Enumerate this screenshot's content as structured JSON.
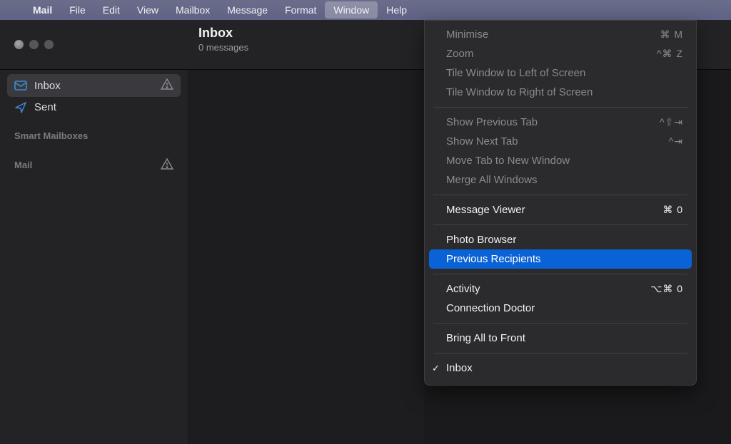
{
  "menubar": {
    "apple": "",
    "items": [
      "Mail",
      "File",
      "Edit",
      "View",
      "Mailbox",
      "Message",
      "Format",
      "Window",
      "Help"
    ],
    "open_index": 7
  },
  "window": {
    "title": "Inbox",
    "subtitle": "0 messages"
  },
  "sidebar": {
    "inbox": "Inbox",
    "sent": "Sent",
    "smart": "Smart Mailboxes",
    "mail": "Mail"
  },
  "menu": {
    "minimise": {
      "label": "Minimise",
      "short": "⌘ M"
    },
    "zoom": {
      "label": "Zoom",
      "short": "^⌘ Z"
    },
    "tile_left": {
      "label": "Tile Window to Left of Screen"
    },
    "tile_right": {
      "label": "Tile Window to Right of Screen"
    },
    "prev_tab": {
      "label": "Show Previous Tab",
      "short": "^⇧⇥"
    },
    "next_tab": {
      "label": "Show Next Tab",
      "short": "^⇥"
    },
    "move_tab": {
      "label": "Move Tab to New Window"
    },
    "merge": {
      "label": "Merge All Windows"
    },
    "msg_viewer": {
      "label": "Message Viewer",
      "short": "⌘ 0"
    },
    "photo": {
      "label": "Photo Browser"
    },
    "prev_rec": {
      "label": "Previous Recipients"
    },
    "activity": {
      "label": "Activity",
      "short": "⌥⌘ 0"
    },
    "conn": {
      "label": "Connection Doctor"
    },
    "front": {
      "label": "Bring All to Front"
    },
    "inbox": {
      "label": "Inbox"
    }
  }
}
